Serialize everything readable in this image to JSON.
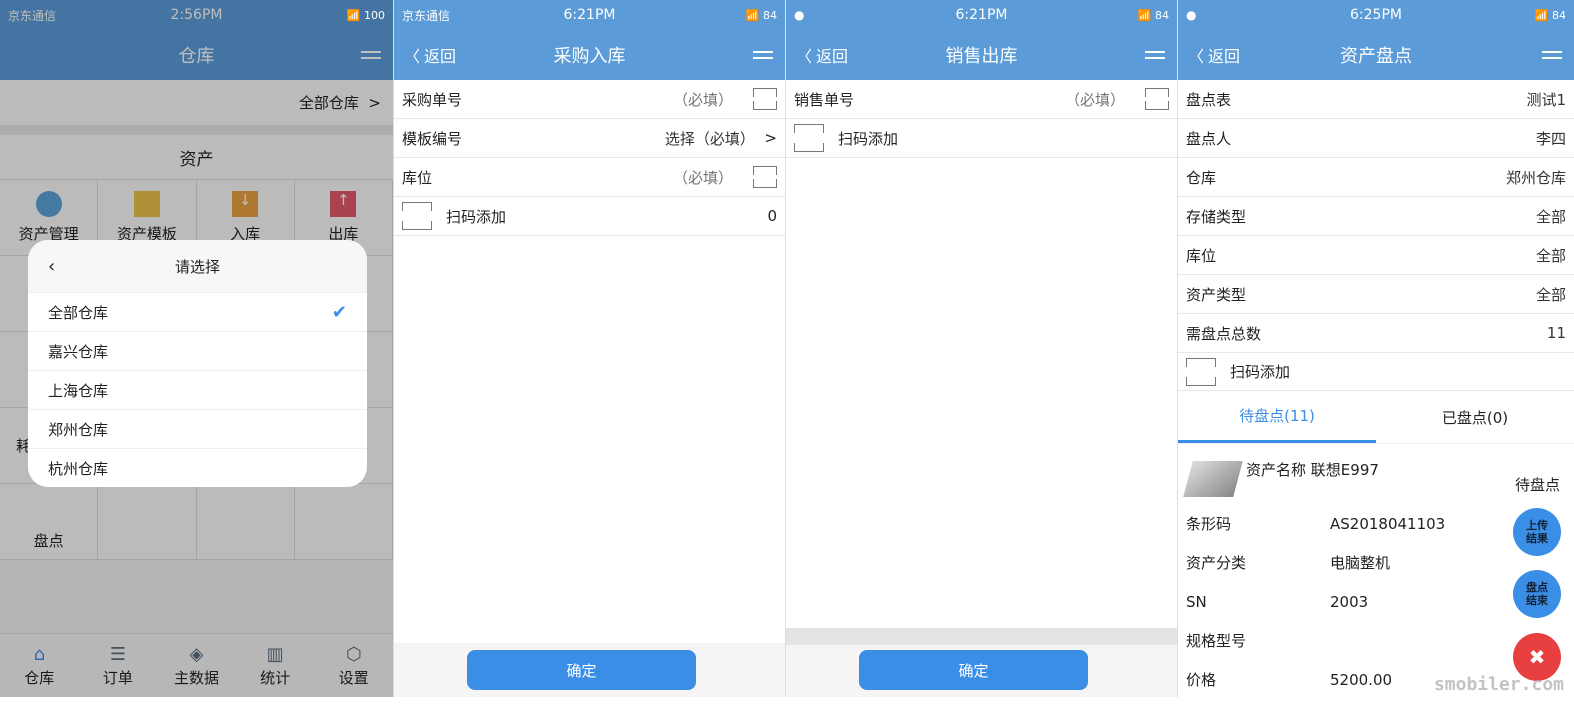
{
  "screens": [
    {
      "carrier": "京东通信",
      "time": "2:56PM",
      "battery": "100",
      "title": "仓库",
      "warehouse_selector": "全部仓库",
      "section": "资产",
      "grid": [
        {
          "label": "资产管理",
          "icon": "pie-chart-icon",
          "color": "#5ba3d9"
        },
        {
          "label": "资产模板",
          "icon": "template-grid-icon",
          "color": "#e8c04a"
        },
        {
          "label": "入库",
          "icon": "download-icon",
          "color": "#e8a040"
        },
        {
          "label": "出库",
          "icon": "upload-icon",
          "color": "#e05a6a"
        }
      ],
      "partial_label": "耗",
      "pandian": "盘点",
      "modal": {
        "title": "请选择",
        "options": [
          "全部仓库",
          "嘉兴仓库",
          "上海仓库",
          "郑州仓库",
          "杭州仓库"
        ],
        "selected": "全部仓库"
      },
      "nav": [
        {
          "label": "仓库",
          "icon": "home-icon"
        },
        {
          "label": "订单",
          "icon": "document-icon"
        },
        {
          "label": "主数据",
          "icon": "layers-icon"
        },
        {
          "label": "统计",
          "icon": "bar-chart-icon"
        },
        {
          "label": "设置",
          "icon": "settings-icon"
        }
      ]
    },
    {
      "carrier": "京东通信",
      "time": "6:21PM",
      "battery": "84",
      "back": "返回",
      "title": "采购入库",
      "rows": [
        {
          "label": "采购单号",
          "hint": "（必填）"
        },
        {
          "label": "模板编号",
          "value": "选择（必填）"
        },
        {
          "label": "库位",
          "hint": "（必填）"
        }
      ],
      "scan_label": "扫码添加",
      "scan_count": "0",
      "confirm": "确定"
    },
    {
      "time": "6:21PM",
      "battery": "84",
      "back": "返回",
      "title": "销售出库",
      "rows": [
        {
          "label": "销售单号",
          "hint": "（必填）"
        }
      ],
      "scan_label": "扫码添加",
      "confirm": "确定"
    },
    {
      "time": "6:25PM",
      "battery": "84",
      "back": "返回",
      "title": "资产盘点",
      "rows": [
        {
          "label": "盘点表",
          "value": "测试1"
        },
        {
          "label": "盘点人",
          "value": "李四"
        },
        {
          "label": "仓库",
          "value": "郑州仓库"
        },
        {
          "label": "存储类型",
          "value": "全部"
        },
        {
          "label": "库位",
          "value": "全部"
        },
        {
          "label": "资产类型",
          "value": "全部"
        },
        {
          "label": "需盘点总数",
          "value": "11"
        }
      ],
      "scan_label": "扫码添加",
      "tabs": [
        "待盘点(11)",
        "已盘点(0)"
      ],
      "card": {
        "name_label": "资产名称",
        "name": "联想E997",
        "status": "待盘点",
        "fields": [
          {
            "k": "条形码",
            "v": "AS2018041103"
          },
          {
            "k": "资产分类",
            "v": "电脑整机"
          },
          {
            "k": "SN",
            "v": "2003"
          },
          {
            "k": "规格型号",
            "v": ""
          },
          {
            "k": "价格",
            "v": "5200.00"
          }
        ]
      },
      "fab_upload": "上传结果",
      "fab_finish": "盘点结束"
    }
  ],
  "watermark": "smobiler.com",
  "colors": {
    "header": "#5b9bd8",
    "accent": "#3a8ee6",
    "delete": "#e84040"
  }
}
